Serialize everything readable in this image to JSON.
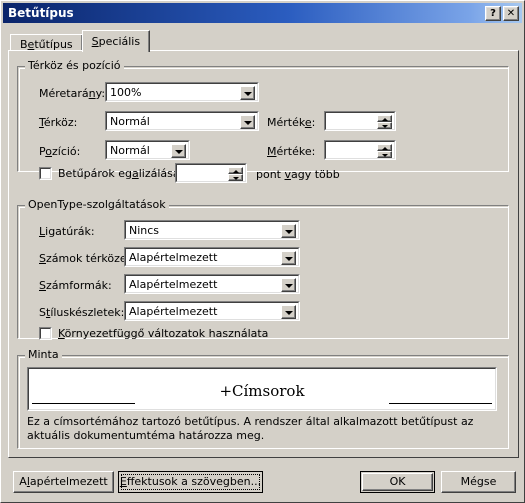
{
  "window": {
    "title": "Betűtípus",
    "help_button": "?",
    "close_button": "✕"
  },
  "tabs": [
    {
      "label_pre": "B",
      "label_accel": "e",
      "label_post": "tűtípus",
      "label": "Betűtípus",
      "active": false
    },
    {
      "label_pre": "",
      "label_accel": "S",
      "label_post": "peciális",
      "label": "Speciális",
      "active": true
    }
  ],
  "spacing_group": {
    "legend": "Térköz és pozíció",
    "scale": {
      "label_pre": "Méretará",
      "label_accel": "n",
      "label_post": "y:",
      "label": "Méretarány:",
      "value": "100%"
    },
    "spacing": {
      "label_pre": "",
      "label_accel": "T",
      "label_post": "érköz:",
      "label": "Térköz:",
      "value": "Normál"
    },
    "spacing_by": {
      "label_pre": "Mérték",
      "label_accel": "e",
      "label_post": ":",
      "label": "Mértéke:",
      "value": ""
    },
    "position": {
      "label_pre": "P",
      "label_accel": "o",
      "label_post": "zíció:",
      "label": "Pozíció:",
      "value": "Normál"
    },
    "position_by": {
      "label_pre": "",
      "label_accel": "M",
      "label_post": "értéke:",
      "label": "Mértéke:",
      "value": ""
    },
    "kerning": {
      "label_pre": "Betűpárok eg",
      "label_accel": "a",
      "label_post": "lizálása:",
      "label": "Betűpárok egalizálása:",
      "checked": false,
      "value": "",
      "suffix_pre": "pont ",
      "suffix_accel": "v",
      "suffix_post": "agy több",
      "suffix": "pont vagy több"
    }
  },
  "opentype_group": {
    "legend": "OpenType-szolgáltatások",
    "ligatures": {
      "label_pre": "",
      "label_accel": "L",
      "label_post": "igatúrák:",
      "label": "Ligatúrák:",
      "value": "Nincs"
    },
    "number_spacing": {
      "label_pre": "",
      "label_accel": "S",
      "label_post": "zámok térköze:",
      "label": "Számok térköze:",
      "value": "Alapértelmezett"
    },
    "number_forms": {
      "label_pre": "",
      "label_accel": "S",
      "label_post": "zámformák:",
      "label": "Számformák:",
      "value": "Alapértelmezett"
    },
    "stylistic_sets": {
      "label_pre": "S",
      "label_accel": "t",
      "label_post": "íluskészletek:",
      "label": "Stíluskészletek:",
      "value": "Alapértelmezett"
    },
    "contextual": {
      "label_pre": "",
      "label_accel": "K",
      "label_post": "örnyezetfüggő változatok használata",
      "label": "Környezetfüggő változatok használata",
      "checked": false
    }
  },
  "preview_group": {
    "legend": "Minta",
    "sample_text": "+Címsorok",
    "description": "Ez a címsortémához tartozó betűtípus. A rendszer által alkalmazott betűtípust az aktuális dokumentumtéma határozza meg."
  },
  "footer": {
    "default_button": {
      "label_pre": "A",
      "label_accel": "l",
      "label_post": "apértelmezett",
      "label": "Alapértelmezett"
    },
    "text_effects_button": {
      "label_pre": "",
      "label_accel": "E",
      "label_post": "ffektusok a szövegben...",
      "label": "Effektusok a szövegben..."
    },
    "ok_button": {
      "label": "OK"
    },
    "cancel_button": {
      "label": "Mégse"
    }
  },
  "colors": {
    "face": "#d4d0c8",
    "title_start": "#0a246a",
    "title_end": "#a6c8f0",
    "field": "#ffffff"
  }
}
